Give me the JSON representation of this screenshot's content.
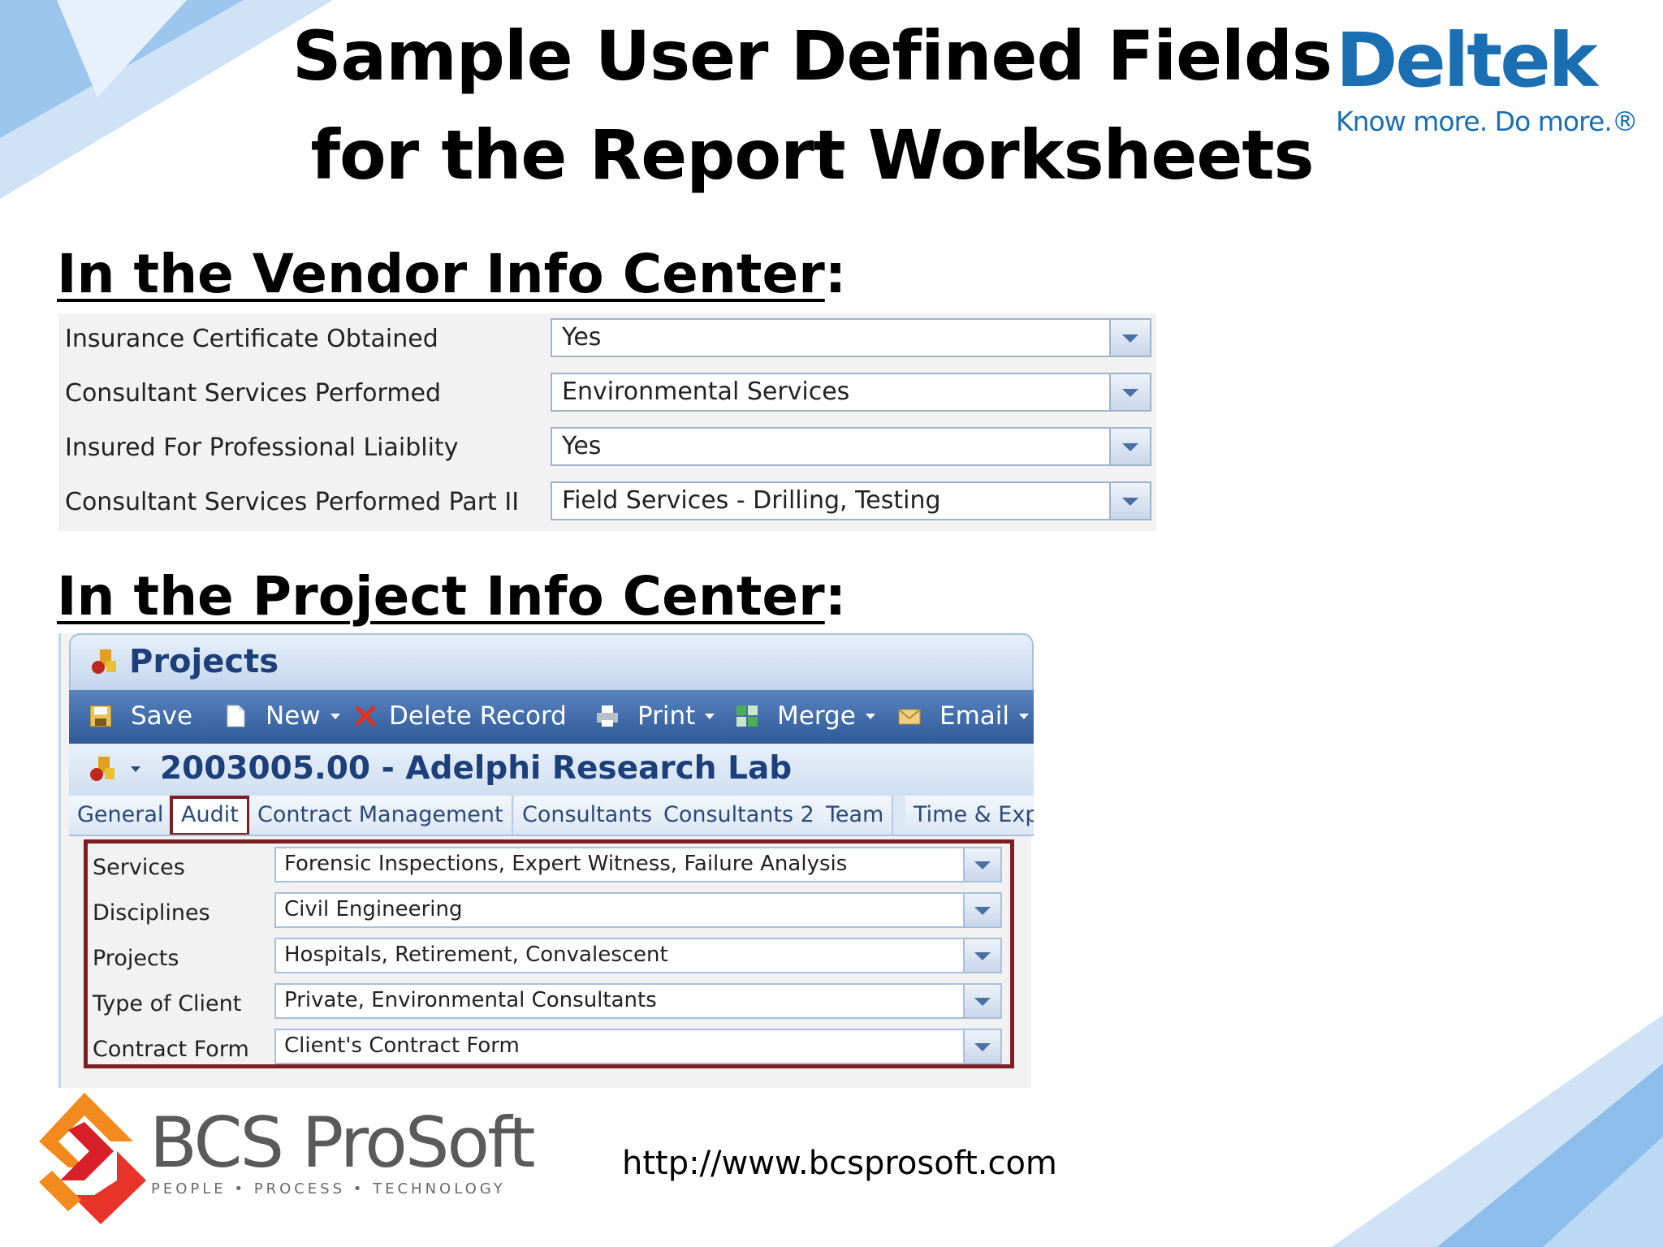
{
  "slide": {
    "title_line1": "Sample User Defined Fields",
    "title_line2": "for the Report Worksheets"
  },
  "brand": {
    "name": "Deltek",
    "tagline": "Know more. Do more.®",
    "color": "#1a6fb3"
  },
  "vendor_section": {
    "heading": "In the Vendor Info Center",
    "colon": ":",
    "fields": [
      {
        "label": "Insurance Certificate Obtained",
        "value": "Yes"
      },
      {
        "label": "Consultant Services Performed",
        "value": "Environmental Services"
      },
      {
        "label": "Insured For Professional Liaiblity",
        "value": "Yes"
      },
      {
        "label": "Consultant Services Performed Part II",
        "value": "Field Services - Drilling, Testing"
      }
    ]
  },
  "project_section": {
    "heading": "In the Project Info Center",
    "colon": ":",
    "window_title": "Projects",
    "toolbar": {
      "save": "Save",
      "new": "New",
      "delete": "Delete Record",
      "print": "Print",
      "merge": "Merge",
      "email": "Email"
    },
    "record_title": "2003005.00 - Adelphi Research Lab",
    "tabs": [
      "General",
      "Audit",
      "Contract Management",
      "Consultants",
      "Consultants 2",
      "Team",
      "Time & Exp"
    ],
    "active_tab": "Audit",
    "fields": [
      {
        "label": "Services",
        "value": "Forensic Inspections, Expert Witness, Failure Analysis"
      },
      {
        "label": "Disciplines",
        "value": "Civil Engineering"
      },
      {
        "label": "Projects",
        "value": "Hospitals, Retirement, Convalescent"
      },
      {
        "label": "Type of Client",
        "value": "Private, Environmental Consultants"
      },
      {
        "label": "Contract Form",
        "value": "Client's Contract Form"
      }
    ],
    "highlight_color": "#7b1f24"
  },
  "footer": {
    "logo_name": "BCS ProSoft",
    "logo_sub": "PEOPLE • PROCESS • TECHNOLOGY",
    "url": "http://www.bcsprosoft.com"
  }
}
